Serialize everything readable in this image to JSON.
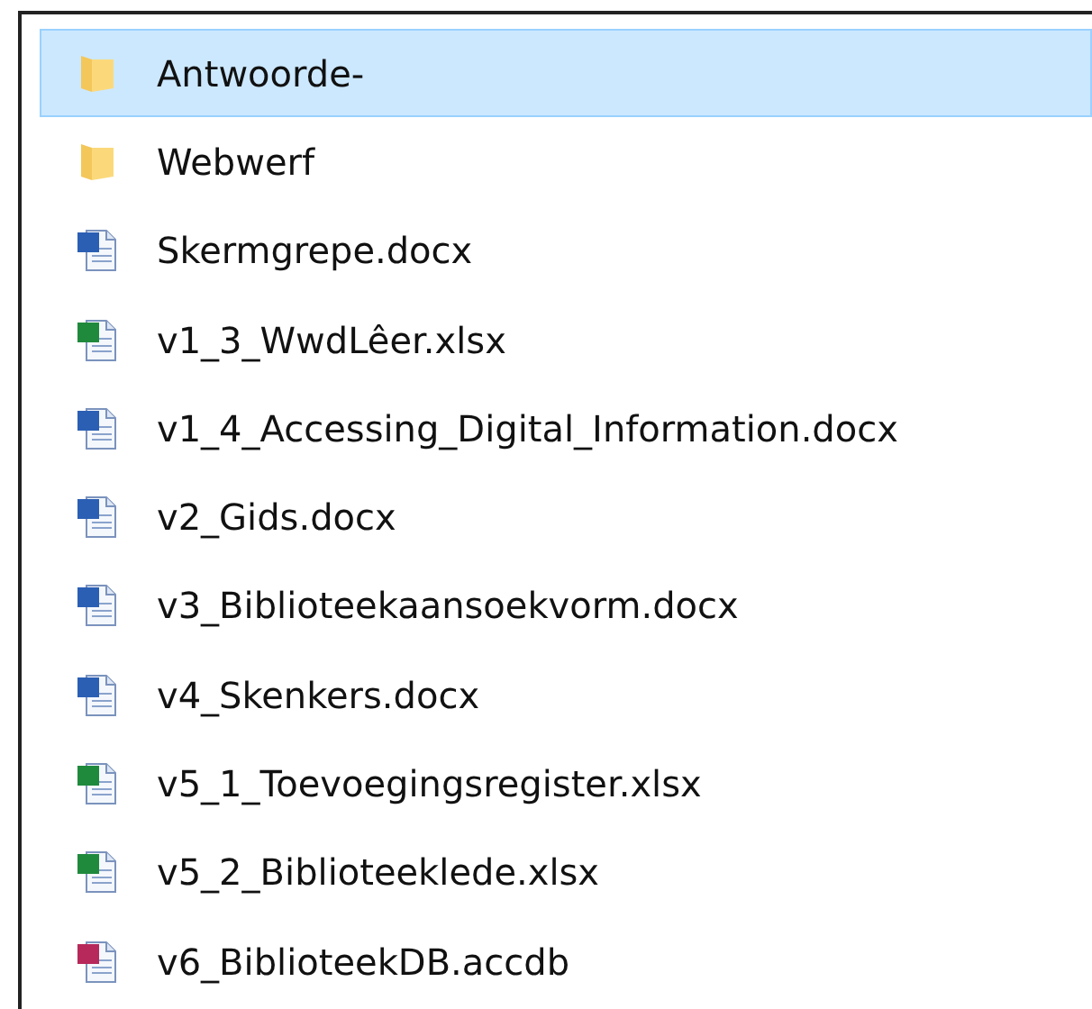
{
  "files": [
    {
      "name": "Antwoorde-",
      "kind": "folder",
      "selected": true
    },
    {
      "name": "Webwerf",
      "kind": "folder",
      "selected": false
    },
    {
      "name": "Skermgrepe.docx",
      "kind": "word",
      "selected": false
    },
    {
      "name": "v1_3_WwdLêer.xlsx",
      "kind": "excel",
      "selected": false
    },
    {
      "name": "v1_4_Accessing_Digital_Information.docx",
      "kind": "word",
      "selected": false
    },
    {
      "name": "v2_Gids.docx",
      "kind": "word",
      "selected": false
    },
    {
      "name": "v3_Biblioteekaansoekvorm.docx",
      "kind": "word",
      "selected": false
    },
    {
      "name": "v4_Skenkers.docx",
      "kind": "word",
      "selected": false
    },
    {
      "name": "v5_1_Toevoegingsregister.xlsx",
      "kind": "excel",
      "selected": false
    },
    {
      "name": "v5_2_Biblioteeklede.xlsx",
      "kind": "excel",
      "selected": false
    },
    {
      "name": "v6_BiblioteekDB.accdb",
      "kind": "access",
      "selected": false
    }
  ]
}
